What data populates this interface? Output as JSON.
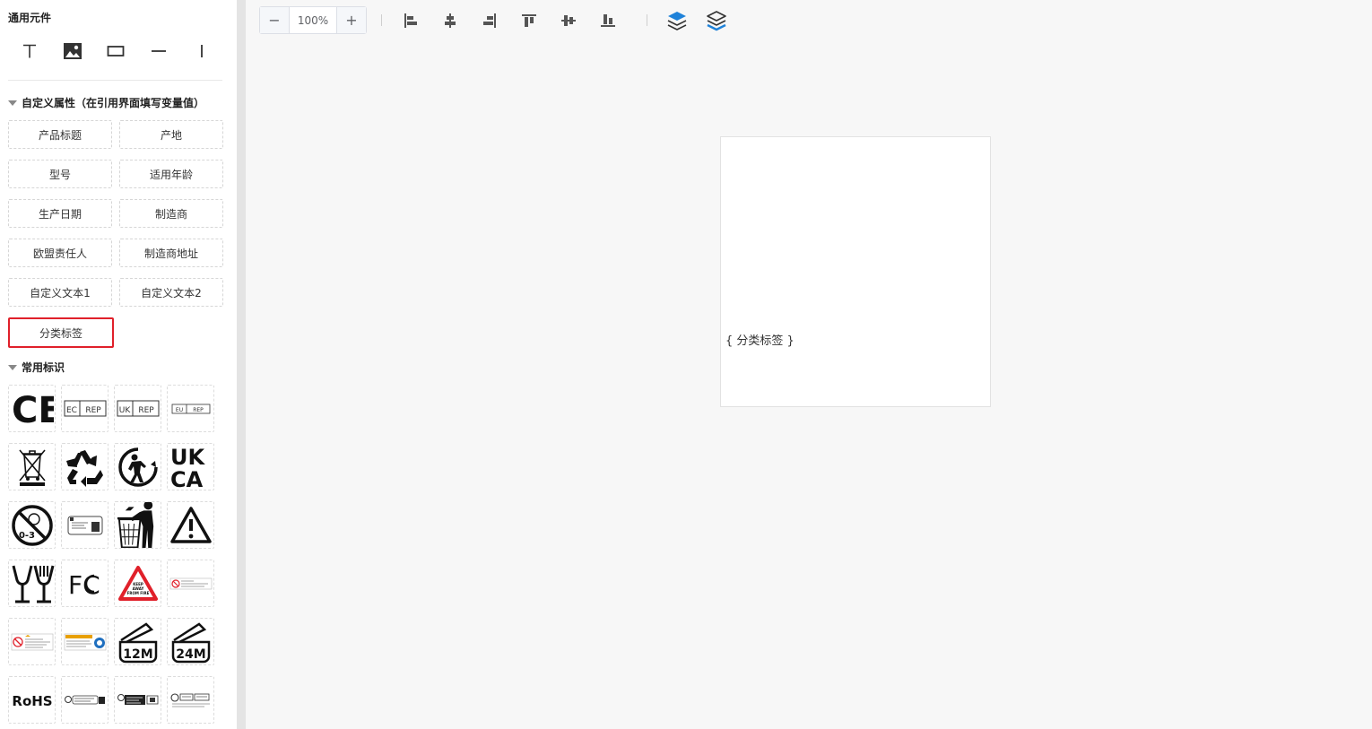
{
  "sidebar": {
    "general_title": "通用元件",
    "general_tools": [
      {
        "name": "text-tool",
        "icon": "text-icon"
      },
      {
        "name": "image-tool",
        "icon": "image-icon"
      },
      {
        "name": "rectangle-tool",
        "icon": "rectangle-icon"
      },
      {
        "name": "horizontal-line-tool",
        "icon": "horizontal-line-icon"
      },
      {
        "name": "vertical-line-tool",
        "icon": "vertical-line-icon"
      }
    ],
    "custom_title": "自定义属性（在引用界面填写变量值）",
    "custom_props": [
      "产品标题",
      "产地",
      "型号",
      "适用年龄",
      "生产日期",
      "制造商",
      "欧盟责任人",
      "制造商地址",
      "自定义文本1",
      "自定义文本2",
      "分类标签"
    ],
    "selected_prop": "分类标签",
    "symbols_title": "常用标识",
    "symbols": {
      "ce": "CE",
      "ec_rep": [
        "EC",
        "REP"
      ],
      "uk_rep": [
        "UK",
        "REP"
      ],
      "eu_rep": [
        "EU",
        "REP"
      ],
      "ukca": [
        "UK",
        "CA"
      ],
      "age_warning": "0-3",
      "fcc": "FC",
      "keep_away": [
        "KEEP",
        "AWAY",
        "FROM FIRE"
      ],
      "pao_12": "12M",
      "pao_24": "24M",
      "rohs": "RoHS"
    },
    "symbol_icons": [
      "ce-mark-icon",
      "ec-rep-icon",
      "uk-rep-icon",
      "eu-rep-icon",
      "weee-bin-icon",
      "recycle-icon",
      "tidyman-recycle-icon",
      "ukca-mark-icon",
      "no-under-3-icon",
      "triman-label-icon",
      "tidyman-bin-icon",
      "warning-triangle-icon",
      "food-safe-icon",
      "fcc-mark-icon",
      "keep-away-from-fire-icon",
      "choking-warning-label-icon",
      "warning-label-small-icon",
      "warning-label-orange-icon",
      "pao-12m-icon",
      "pao-24m-icon",
      "rohs-mark-icon",
      "recycling-info-label-icon",
      "recycling-info-label-2-icon",
      "recycling-info-label-3-icon"
    ]
  },
  "toolbar": {
    "zoom_minus": "−",
    "zoom_value": "100%",
    "zoom_plus": "+",
    "align_buttons": [
      "align-left-icon",
      "align-horizontal-center-icon",
      "align-right-icon",
      "align-top-icon",
      "align-vertical-center-icon",
      "align-bottom-icon"
    ],
    "layer_buttons": [
      "bring-forward-icon",
      "send-backward-icon"
    ],
    "accent_color": "#1f82d9"
  },
  "canvas": {
    "placeholder_text": "{ 分类标签 }"
  },
  "colors": {
    "selected_border": "#e0202a",
    "canvas_bg": "#f7f7f7"
  }
}
